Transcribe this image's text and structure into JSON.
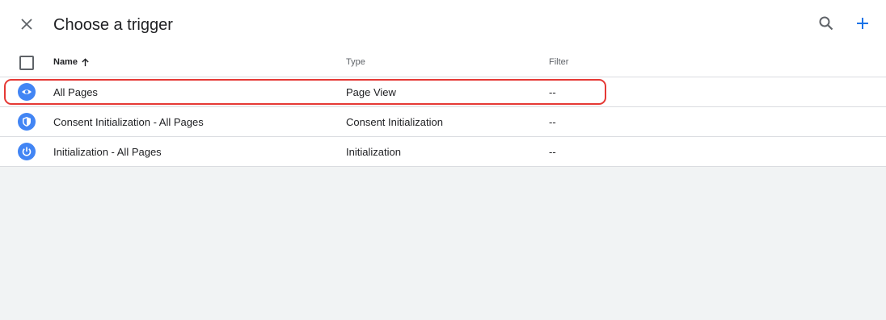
{
  "header": {
    "title": "Choose a trigger",
    "close_icon": "close-icon",
    "search_icon": "search-icon",
    "add_icon": "plus-icon",
    "accent_color": "#1a73e8"
  },
  "table": {
    "columns": {
      "name": "Name",
      "type": "Type",
      "filter": "Filter"
    },
    "sort_icon": "arrow-up-icon",
    "rows": [
      {
        "icon": "eye-icon",
        "name": "All Pages",
        "type": "Page View",
        "filter": "--",
        "highlighted": true
      },
      {
        "icon": "shield-icon",
        "name": "Consent Initialization - All Pages",
        "type": "Consent Initialization",
        "filter": "--",
        "highlighted": false
      },
      {
        "icon": "power-icon",
        "name": "Initialization - All Pages",
        "type": "Initialization",
        "filter": "--",
        "highlighted": false
      }
    ],
    "icon_background": "#4285f4",
    "highlight_color": "#e53935"
  }
}
